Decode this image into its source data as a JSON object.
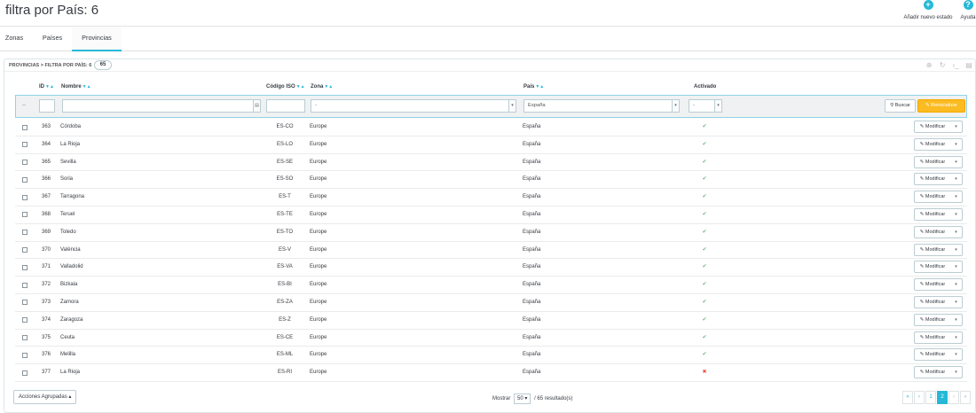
{
  "page": {
    "title": "filtra por País: 6"
  },
  "toolbar": {
    "add_label": "Añadir nuevo estado",
    "add_icon": "plus-circle-icon",
    "help_label": "Ayuda",
    "help_icon": "question-circle-icon"
  },
  "tabs": [
    {
      "label": "Zonas",
      "active": false
    },
    {
      "label": "Países",
      "active": false
    },
    {
      "label": "Provincias",
      "active": true
    }
  ],
  "panel": {
    "breadcrumb": "PROVINCIAS > FILTRA POR PAÍS: 6",
    "count": "65"
  },
  "columns": {
    "id": "ID",
    "name": "Nombre",
    "iso": "Código ISO",
    "zone": "Zona",
    "country": "País",
    "active": "Activado"
  },
  "filters": {
    "dash": "--",
    "zone": "-",
    "country": "España",
    "active": "-",
    "search_label": "Buscar",
    "reset_label": "Reinicializar"
  },
  "rows": [
    {
      "id": "363",
      "name": "Córdoba",
      "iso": "ES-CO",
      "zone": "Europe",
      "country": "España",
      "active": true
    },
    {
      "id": "364",
      "name": "La Rioja",
      "iso": "ES-LO",
      "zone": "Europe",
      "country": "España",
      "active": true
    },
    {
      "id": "365",
      "name": "Sevilla",
      "iso": "ES-SE",
      "zone": "Europe",
      "country": "España",
      "active": true
    },
    {
      "id": "366",
      "name": "Soria",
      "iso": "ES-SO",
      "zone": "Europe",
      "country": "España",
      "active": true
    },
    {
      "id": "367",
      "name": "Tarragona",
      "iso": "ES-T",
      "zone": "Europe",
      "country": "España",
      "active": true
    },
    {
      "id": "368",
      "name": "Teruel",
      "iso": "ES-TE",
      "zone": "Europe",
      "country": "España",
      "active": true
    },
    {
      "id": "369",
      "name": "Toledo",
      "iso": "ES-TO",
      "zone": "Europe",
      "country": "España",
      "active": true
    },
    {
      "id": "370",
      "name": "València",
      "iso": "ES-V",
      "zone": "Europe",
      "country": "España",
      "active": true
    },
    {
      "id": "371",
      "name": "Valladolid",
      "iso": "ES-VA",
      "zone": "Europe",
      "country": "España",
      "active": true
    },
    {
      "id": "372",
      "name": "Bizkaia",
      "iso": "ES-BI",
      "zone": "Europe",
      "country": "España",
      "active": true
    },
    {
      "id": "373",
      "name": "Zamora",
      "iso": "ES-ZA",
      "zone": "Europe",
      "country": "España",
      "active": true
    },
    {
      "id": "374",
      "name": "Zaragoza",
      "iso": "ES-Z",
      "zone": "Europe",
      "country": "España",
      "active": true
    },
    {
      "id": "375",
      "name": "Ceuta",
      "iso": "ES-CE",
      "zone": "Europe",
      "country": "España",
      "active": true
    },
    {
      "id": "376",
      "name": "Melilla",
      "iso": "ES-ML",
      "zone": "Europe",
      "country": "España",
      "active": true
    },
    {
      "id": "377",
      "name": "La Rioja",
      "iso": "ES-RI",
      "zone": "Europe",
      "country": "España",
      "active": false
    }
  ],
  "row_action": {
    "edit_label": "Modificar"
  },
  "footer": {
    "bulk_label": "Acciones Agrupadas",
    "show_label": "Mostrar",
    "per_page": "50",
    "results_label": "/ 65 resultado(s)",
    "pages": [
      "«",
      "‹",
      "1",
      "2",
      "›",
      "»"
    ],
    "current_page": "2"
  },
  "colors": {
    "accent": "#25b9d7",
    "reset": "#fbbb22",
    "success": "#70b580",
    "danger": "#f54c3e"
  }
}
